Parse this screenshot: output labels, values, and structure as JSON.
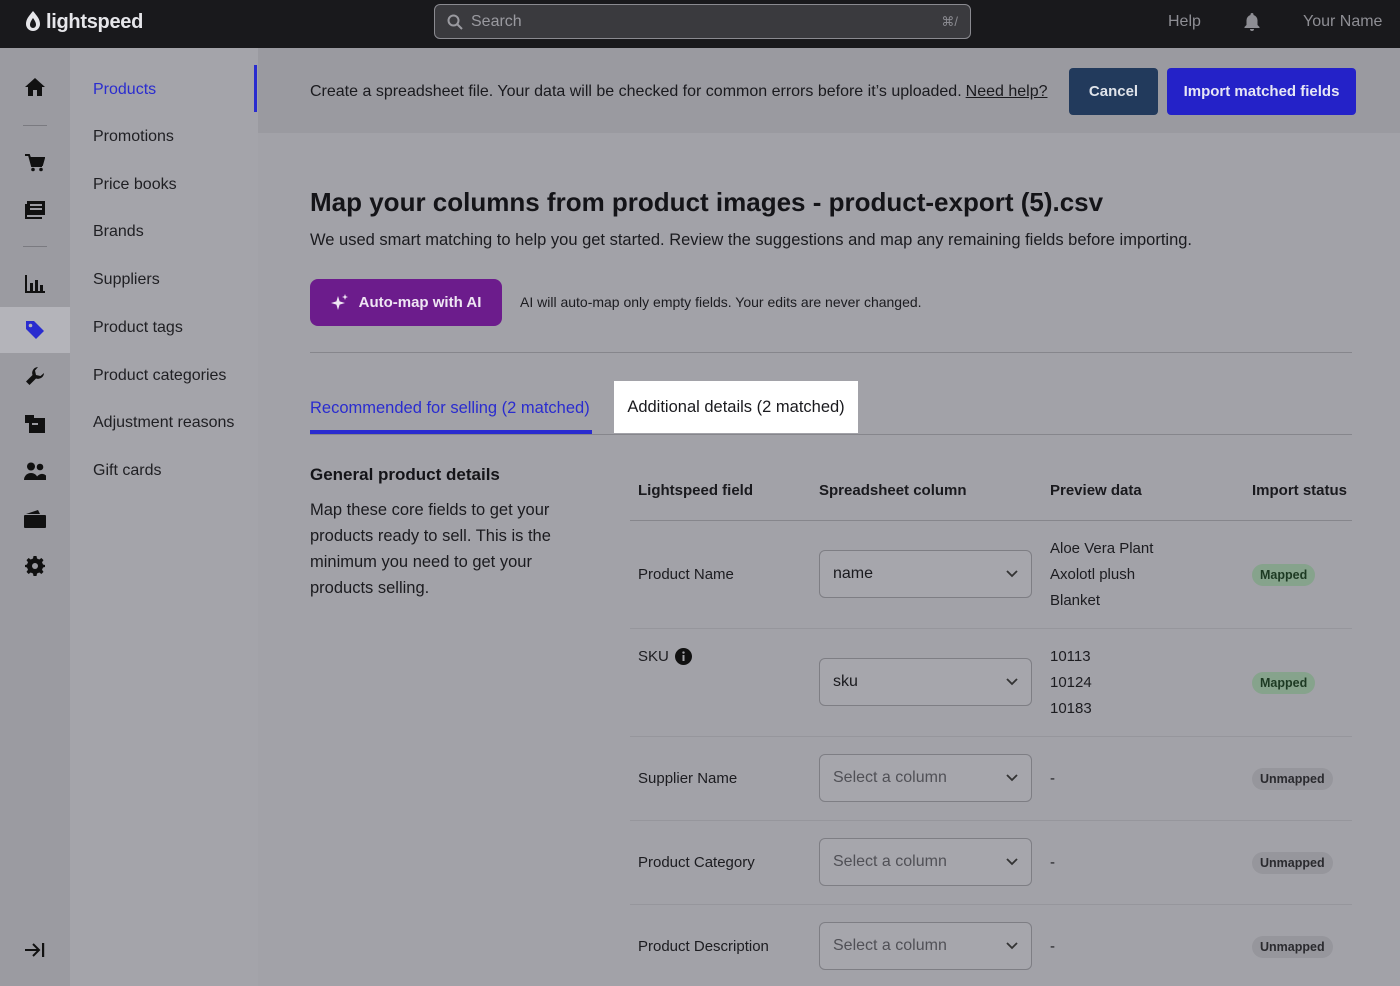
{
  "topbar": {
    "brand": "lightspeed",
    "search_placeholder": "Search",
    "search_shortcut": "⌘/",
    "help_label": "Help",
    "user_name": "Your Name"
  },
  "rail": {
    "icons": [
      "home-icon",
      "cart-icon",
      "register-icon",
      "reports-icon",
      "tag-icon",
      "wrench-icon",
      "inventory-icon",
      "customers-icon",
      "wallet-icon",
      "settings-icon"
    ],
    "active": "tag-icon",
    "bottom_icon": "expand-sidebar-icon"
  },
  "subnav": {
    "items": [
      "Products",
      "Promotions",
      "Price books",
      "Brands",
      "Suppliers",
      "Product tags",
      "Product categories",
      "Adjustment reasons",
      "Gift cards"
    ],
    "active": "Products"
  },
  "banner": {
    "text": "Create a spreadsheet file. Your data will be checked for common errors before it’s uploaded.",
    "help_link": "Need help?",
    "cancel_label": "Cancel",
    "import_label": "Import matched fields"
  },
  "main": {
    "title": "Map your columns from product images - product-export (5).csv",
    "subtitle": "We used smart matching to help you get started. Review the suggestions and map any remaining fields before importing.",
    "ai_button_label": "Auto-map with AI",
    "ai_note": "AI will auto-map only empty fields. Your edits are never changed.",
    "tabs": [
      {
        "label": "Recommended for selling (2 matched)",
        "active": true
      },
      {
        "label": "Additional details (2 matched)",
        "active": false
      }
    ],
    "section_title": "General product details",
    "section_desc": "Map these core fields to get your products ready to sell. This is the minimum you need to get your products selling."
  },
  "table": {
    "headers": [
      "Lightspeed field",
      "Spreadsheet column",
      "Preview data",
      "Import status"
    ],
    "rows": [
      {
        "field": "Product Name",
        "column": "name",
        "preview_1": "Aloe Vera Plant",
        "preview_2": "Axolotl plush",
        "preview_3": "Blanket",
        "status": "Mapped"
      },
      {
        "field": "SKU",
        "column": "sku",
        "preview_1": "10113",
        "preview_2": "10124",
        "preview_3": "10183",
        "status": "Mapped"
      },
      {
        "field": "Supplier Name",
        "column": "Select a column",
        "preview_1": "-",
        "status": "Unmapped"
      },
      {
        "field": "Product Category",
        "column": "Select a column",
        "preview_1": "-",
        "status": "Unmapped"
      },
      {
        "field": "Product Description",
        "column": "Select a column",
        "preview_1": "-",
        "status": "Unmapped"
      }
    ]
  },
  "colors": {
    "accent": "#2a2ccf",
    "ai_purple": "#6c1c8c",
    "cancel_navy": "#223a5c",
    "mapped_green": "#86a38c"
  }
}
